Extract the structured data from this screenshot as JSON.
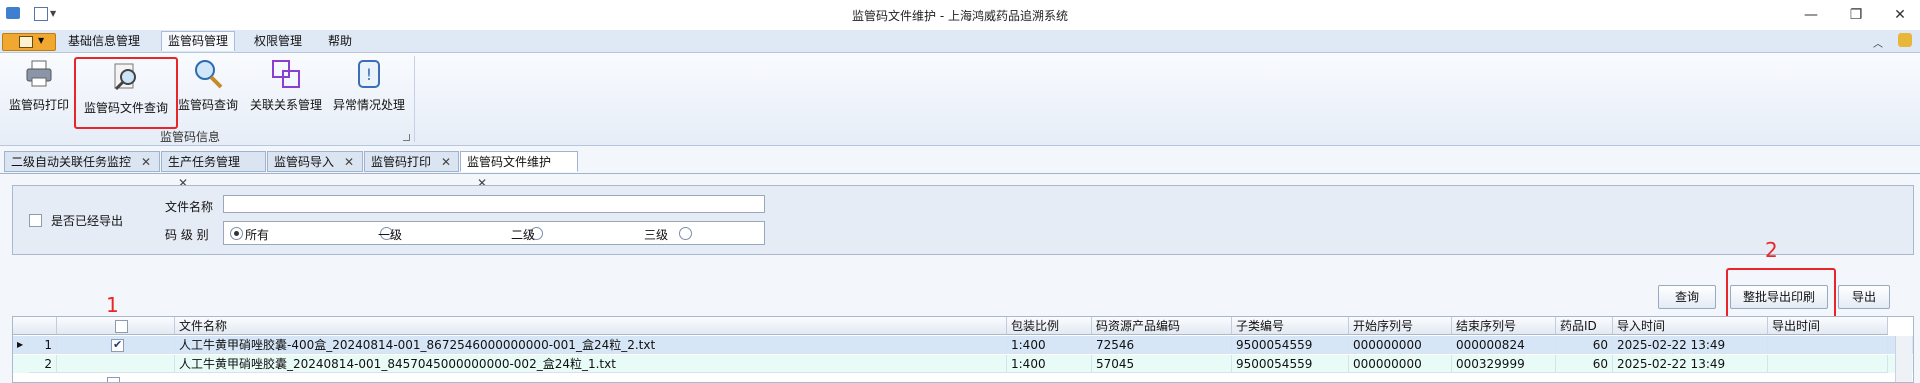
{
  "window": {
    "title": "监管码文件维护 - 上海鸿威药品追溯系统"
  },
  "ribbon_tabs": [
    "基础信息管理",
    "监管码管理",
    "权限管理",
    "帮助"
  ],
  "ribbon_buttons": [
    "监管码打印",
    "监管码文件查询",
    "监管码查询",
    "关联关系管理",
    "异常情况处理"
  ],
  "ribbon_group_label": "监管码信息",
  "doc_tabs": [
    "二级自动关联任务监控",
    "生产任务管理",
    "监管码导入",
    "监管码打印",
    "监管码文件维护"
  ],
  "filter": {
    "exported_label": "是否已经导出",
    "filename_label": "文件名称",
    "filename_value": "",
    "level_label": "码 级 别",
    "level_options": [
      "所有",
      "一级",
      "二级",
      "三级"
    ],
    "level_selected": "所有"
  },
  "toolbar": {
    "query": "查询",
    "batch_export_print": "整批导出印刷",
    "export": "导出"
  },
  "annotations": {
    "one": "1",
    "two": "2"
  },
  "grid": {
    "columns": [
      "文件名称",
      "包装比例",
      "码资源产品编码",
      "子类编号",
      "开始序列号",
      "结束序列号",
      "药品ID",
      "导入时间",
      "导出时间"
    ],
    "rows": [
      {
        "idx": "1",
        "checked": true,
        "file": "人工牛黄甲硝唑胶囊-400盒_20240814-001_8672546000000000-001_盒24粒_2.txt",
        "ratio": "1:400",
        "code": "72546",
        "sub": "9500054559",
        "start": "000000000",
        "end": "000000824",
        "drug": "60",
        "imported": "2025-02-22 13:49",
        "exported": ""
      },
      {
        "idx": "2",
        "checked": false,
        "file": "人工牛黄甲硝唑胶囊_20240814-001_8457045000000000-002_盒24粒_1.txt",
        "ratio": "1:400",
        "code": "57045",
        "sub": "9500054559",
        "start": "000000000",
        "end": "000329999",
        "drug": "60",
        "imported": "2025-02-22 13:49",
        "exported": ""
      }
    ]
  },
  "colors": {
    "accent_red": "#e8262a",
    "row_selected": "#d7e6f7",
    "row_alt": "#e8fbf7"
  }
}
